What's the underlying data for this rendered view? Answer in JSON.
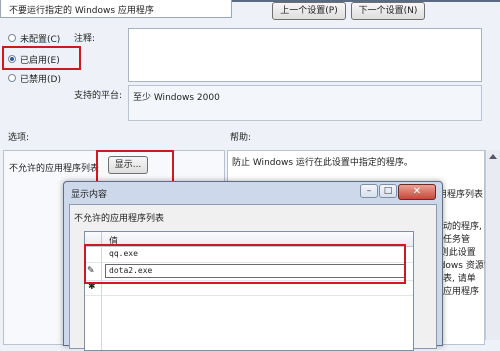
{
  "policy_title": "不要运行指定的 Windows 应用程序",
  "nav": {
    "prev_label": "上一个设置(P)",
    "next_label": "下一个设置(N)"
  },
  "radios": [
    {
      "label": "未配置(C)",
      "selected": false
    },
    {
      "label": "已启用(E)",
      "selected": true
    },
    {
      "label": "已禁用(D)",
      "selected": false
    }
  ],
  "comment_label": "注释:",
  "supported_label": "支持的平台:",
  "supported_value": "至少 Windows 2000",
  "options_label": "选项:",
  "help_label": "帮助:",
  "disallowed_list_label": "不允许的应用程序列表",
  "show_button_label": "显示...",
  "help_text_first": "防止 Windows 运行在此设置中指定的程序。",
  "help_fragments": [
    "用程序列表",
    "启动的程序,",
    "如任务管",
    ", 则此设置",
    "ndows 资源管",
    "列表, 请单",
    "入应用程序"
  ],
  "dialog": {
    "title": "显示内容",
    "close_glyph": "✕",
    "list_label": "不允许的应用程序列表",
    "column_header": "值",
    "rows": [
      {
        "marker": "",
        "value": "qq.exe"
      },
      {
        "marker": "✎",
        "value": "dota2.exe"
      },
      {
        "marker": "✱",
        "value": ""
      }
    ]
  },
  "colors": {
    "highlight": "#d01820",
    "background": "#eef2f8",
    "dialog_title": "#cdd9ea"
  }
}
